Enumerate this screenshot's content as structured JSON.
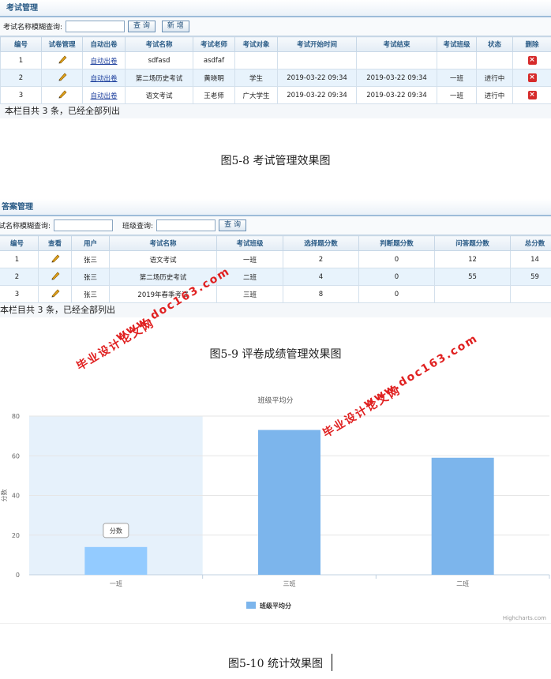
{
  "exam_panel": {
    "title": "考试管理",
    "search_label": "考试名称模糊查询:",
    "search_button": "查 询",
    "add_button": "新 增",
    "columns": [
      "编号",
      "试卷管理",
      "自动出卷",
      "考试名称",
      "考试老师",
      "考试对象",
      "考试开始时间",
      "考试结束",
      "考试班级",
      "状态",
      "删除"
    ],
    "rows": [
      {
        "id": "1",
        "auto": "自动出卷",
        "name": "sdfasd",
        "teacher": "asdfaf",
        "target": "",
        "start": "",
        "end": "",
        "class": "",
        "status": ""
      },
      {
        "id": "2",
        "auto": "自动出卷",
        "name": "第二场历史考试",
        "teacher": "黄晓明",
        "target": "学生",
        "start": "2019-03-22 09:34",
        "end": "2019-03-22 09:34",
        "class": "一班",
        "status": "进行中"
      },
      {
        "id": "3",
        "auto": "自动出卷",
        "name": "语文考试",
        "teacher": "王老师",
        "target": "广大学生",
        "start": "2019-03-22 09:34",
        "end": "2019-03-22 09:34",
        "class": "一班",
        "status": "进行中"
      }
    ],
    "footer": "本栏目共 3 条，已经全部列出"
  },
  "caption1": "图5-8 考试管理效果图",
  "answer_panel": {
    "title": "答案管理",
    "search_label": "试名称模糊查询:",
    "class_label": "班级查询:",
    "search_button": "查 询",
    "columns": [
      "编号",
      "查看",
      "用户",
      "考试名称",
      "考试班级",
      "选择题分数",
      "判断题分数",
      "问答题分数",
      "总分数"
    ],
    "rows": [
      {
        "id": "1",
        "user": "张三",
        "name": "语文考试",
        "class": "一班",
        "choice": "2",
        "judge": "0",
        "qa": "12",
        "total": "14"
      },
      {
        "id": "2",
        "user": "张三",
        "name": "第二场历史考试",
        "class": "二班",
        "choice": "4",
        "judge": "0",
        "qa": "55",
        "total": "59"
      },
      {
        "id": "3",
        "user": "张三",
        "name": "2019年春季考试",
        "class": "三班",
        "choice": "8",
        "judge": "0",
        "qa": "",
        "total": ""
      }
    ],
    "footer": "本栏目共 3 条，已经全部列出"
  },
  "caption2": "图5-9 评卷成绩管理效果图",
  "watermark": {
    "text1": "毕业设计论文网",
    "text2": "www.doc163.com"
  },
  "chart_data": {
    "type": "bar",
    "title": "班级平均分",
    "ylabel": "分数",
    "xlabel": "",
    "categories": [
      "一班",
      "三班",
      "二班"
    ],
    "series": [
      {
        "name": "班级平均分",
        "values": [
          14,
          73,
          59
        ]
      }
    ],
    "ylim": [
      0,
      80
    ],
    "yticks": [
      0,
      20,
      40,
      60,
      80
    ],
    "grid": true,
    "legend": "bottom",
    "tooltip": "分数",
    "credit": "Highcharts.com",
    "colors": {
      "bar": "#7cb5ec",
      "bar_hover": "#93cbff",
      "band": "#e6f1fb"
    }
  },
  "caption3": "图5-10 统计效果图"
}
